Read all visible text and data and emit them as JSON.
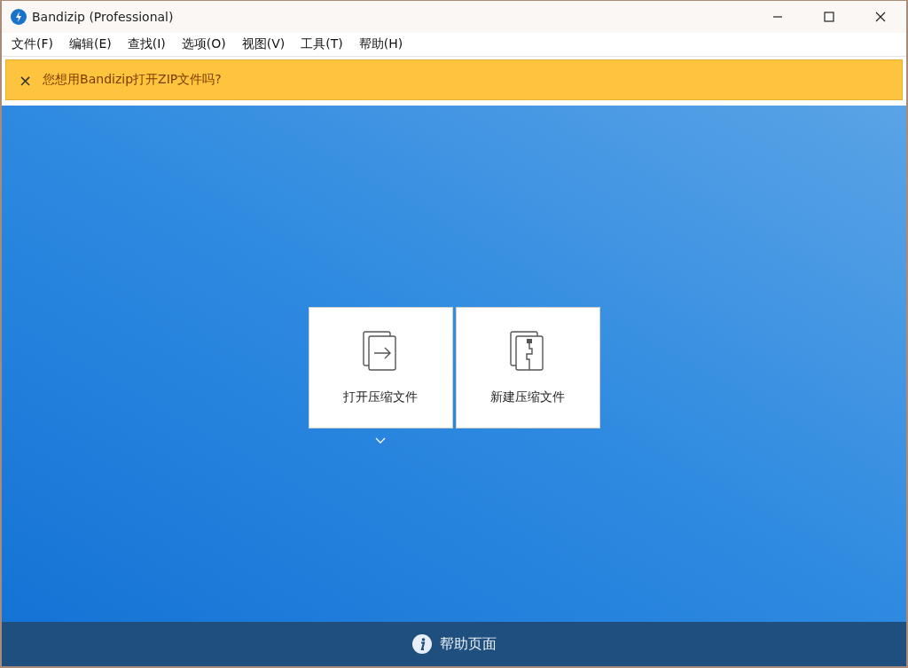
{
  "window": {
    "title": "Bandizip (Professional)"
  },
  "menu": [
    {
      "label": "文件(F)"
    },
    {
      "label": "编辑(E)"
    },
    {
      "label": "查找(I)"
    },
    {
      "label": "选项(O)"
    },
    {
      "label": "视图(V)"
    },
    {
      "label": "工具(T)"
    },
    {
      "label": "帮助(H)"
    }
  ],
  "notification": {
    "close": "×",
    "message": "您想用Bandizip打开ZIP文件吗?"
  },
  "actions": [
    {
      "kind": "open",
      "label": "打开压缩文件",
      "has_dropdown": true
    },
    {
      "kind": "new",
      "label": "新建压缩文件",
      "has_dropdown": false
    }
  ],
  "footer": {
    "label": "帮助页面"
  }
}
